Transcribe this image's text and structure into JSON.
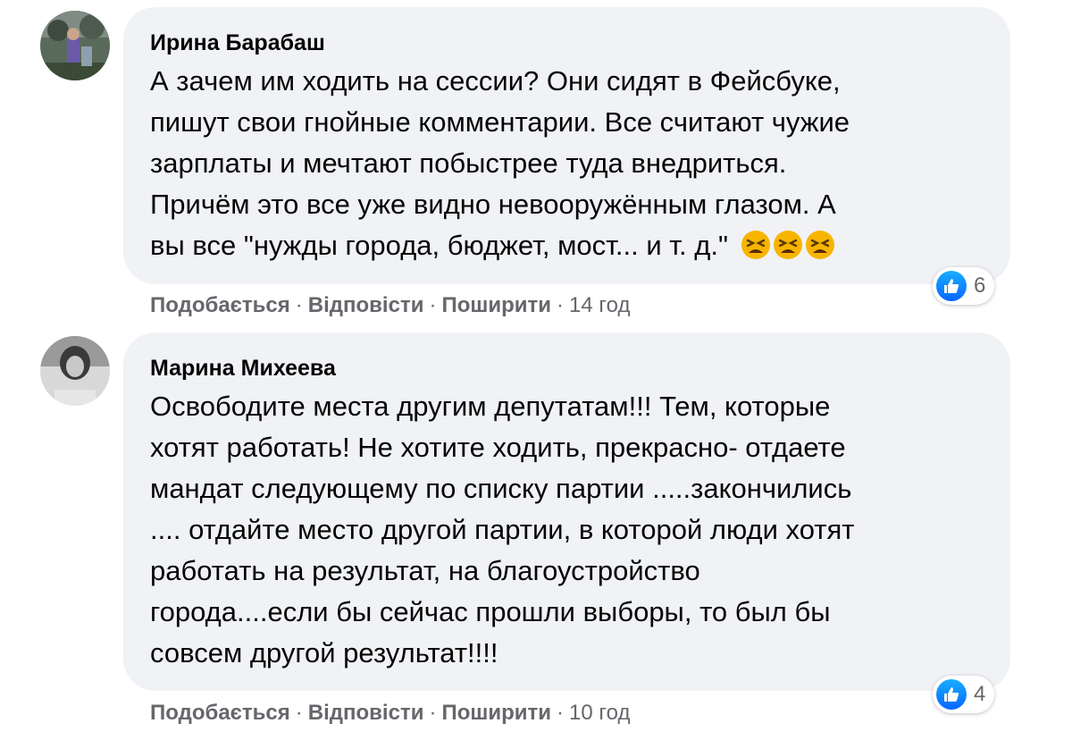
{
  "comments": [
    {
      "author": "Ирина Барабаш",
      "text": "А зачем им ходить на сессии? Они сидят в Фейсбуке,\nпишут свои гнойные комментарии. Все считают чужие\nзарплаты и мечтают побыстрее туда внедриться.\nПричём это все уже видно невооружённым глазом. А\nвы все \"нужды города, бюджет, мост... и т. д.\"",
      "emojis": [
        "tired-face-emoji",
        "tired-face-emoji",
        "tired-face-emoji"
      ],
      "reaction": {
        "icon": "like-icon",
        "count": "6"
      },
      "actions": {
        "like": "Подобається",
        "reply": "Відповісти",
        "share": "Поширити",
        "time": "14 год"
      }
    },
    {
      "author": "Марина Михеева",
      "text": "Освободите места другим депутатам!!! Тем, которые\nхотят работать! Не хотите ходить, прекрасно- отдаете\nмандат следующему по списку партии .....закончились\n.... отдайте место другой партии, в которой люди хотят\nработать на результат, на благоустройство\nгорода....если бы сейчас прошли выборы, то был бы\nсовсем другой результат!!!!",
      "reaction": {
        "icon": "like-icon",
        "count": "4"
      },
      "actions": {
        "like": "Подобається",
        "reply": "Відповісти",
        "share": "Поширити",
        "time": "10 год"
      }
    }
  ],
  "separator": "·",
  "colors": {
    "bubble": "#f0f2f5",
    "meta": "#65676b",
    "like_blue": "#0866ff"
  }
}
